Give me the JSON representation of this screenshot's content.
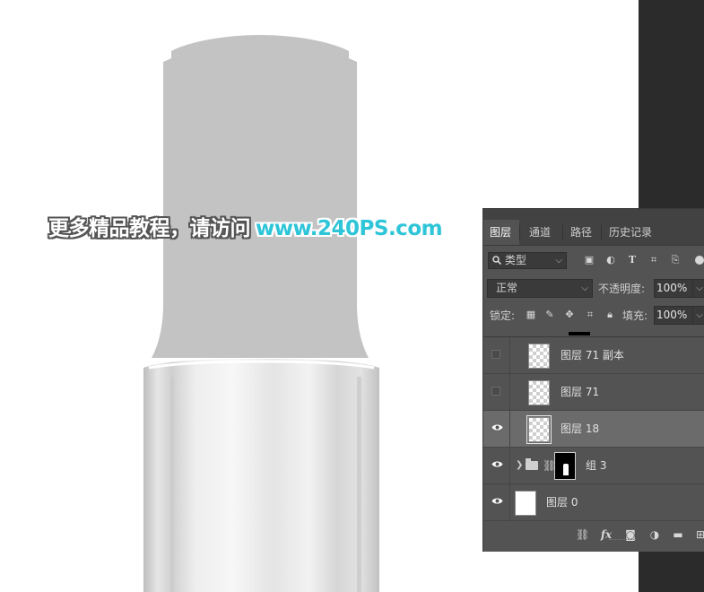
{
  "watermark": {
    "text": "更多精品教程，请访问",
    "url": "www.240PS.com"
  },
  "layers_panel": {
    "tabs": [
      {
        "label": "图层",
        "active": true
      },
      {
        "label": "通道",
        "active": false
      },
      {
        "label": "路径",
        "active": false
      },
      {
        "label": "历史记录",
        "active": false
      }
    ],
    "filter": {
      "label": "类型",
      "icon": "search-icon"
    },
    "filter_icons": [
      "image-filter-icon",
      "adjustment-filter-icon",
      "type-filter-icon",
      "shape-filter-icon",
      "smart-object-filter-icon",
      "filter-toggle-icon"
    ],
    "blend_mode": "正常",
    "opacity_label": "不透明度:",
    "opacity_value": "100%",
    "lock_label": "锁定:",
    "lock_icons": [
      "lock-transparent-icon",
      "lock-paint-icon",
      "lock-position-icon",
      "lock-artboard-icon",
      "lock-all-icon"
    ],
    "fill_label": "填充:",
    "fill_value": "100%",
    "layers": [
      {
        "name": "图层 71 副本",
        "visible": false,
        "thumb": "transparent"
      },
      {
        "name": "图层 71",
        "visible": false,
        "thumb": "transparent"
      },
      {
        "name": "图层 18",
        "visible": true,
        "thumb": "transparent",
        "selected": true
      },
      {
        "name": "组 3",
        "visible": true,
        "thumb": "mask",
        "group": true
      },
      {
        "name": "图层 0",
        "visible": true,
        "thumb": "white"
      }
    ],
    "bottom_icons": [
      "link-layers-icon",
      "fx-icon",
      "add-mask-icon",
      "adjustment-layer-icon",
      "new-group-icon",
      "new-layer-icon"
    ]
  },
  "colors": {
    "panel_bg": "#535353",
    "selected_row": "#6b6b6b",
    "cap_gray": "#c3c3c3",
    "watermark_url": "#2ec5d8"
  }
}
